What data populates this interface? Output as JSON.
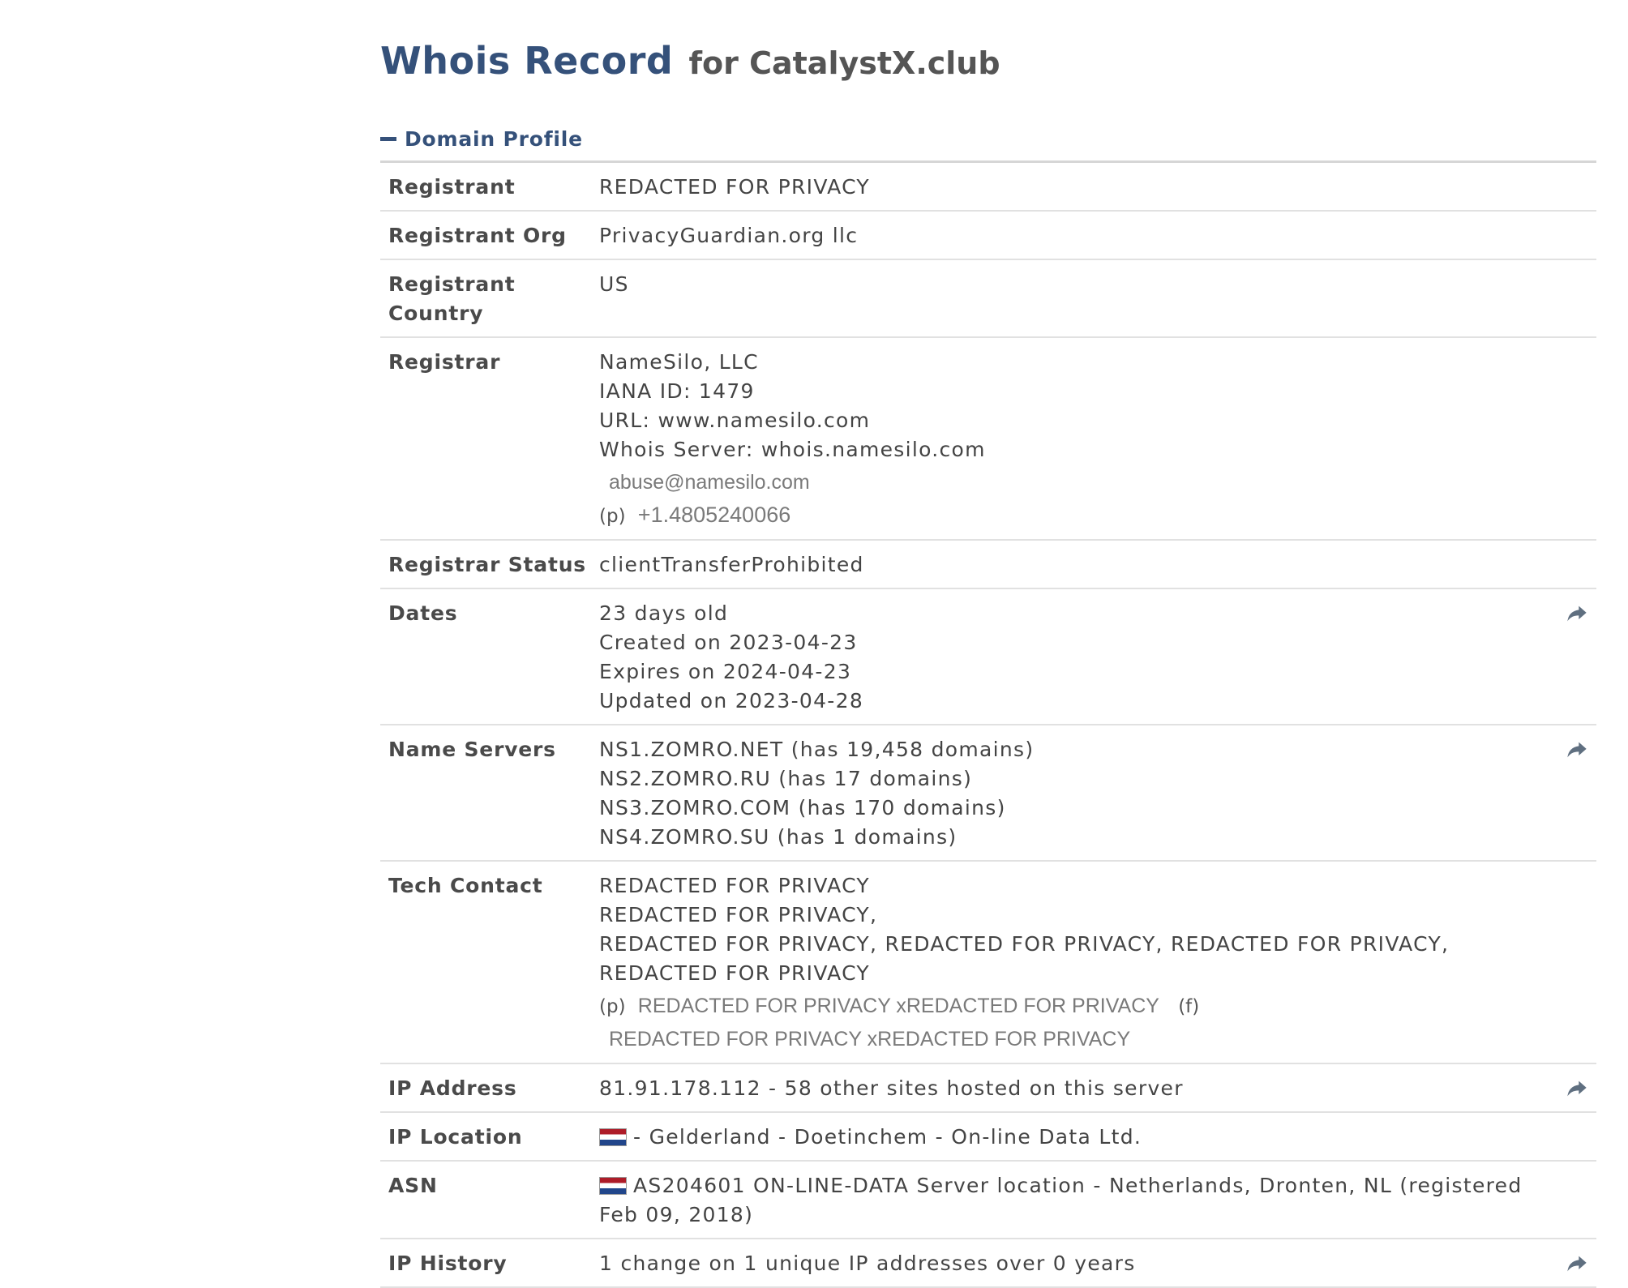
{
  "title": {
    "main": "Whois Record",
    "sub": "for CatalystX.club"
  },
  "section": {
    "label": "Domain Profile"
  },
  "rows": {
    "registrant": {
      "label": "Registrant",
      "value": "REDACTED FOR PRIVACY"
    },
    "registrant_org": {
      "label": "Registrant Org",
      "value": "PrivacyGuardian.org llc"
    },
    "registrant_country": {
      "label": "Registrant Country",
      "value": "US"
    },
    "registrar": {
      "label": "Registrar",
      "lines": [
        "NameSilo, LLC",
        "IANA ID: 1479",
        "URL: www.namesilo.com",
        "Whois Server: whois.namesilo.com"
      ],
      "email": "abuse@namesilo.com",
      "phone_prefix": "(p)",
      "phone": "+1.4805240066"
    },
    "registrar_status": {
      "label": "Registrar Status",
      "value": "clientTransferProhibited"
    },
    "dates": {
      "label": "Dates",
      "lines": [
        "23 days old",
        "Created on 2023-04-23",
        "Expires on 2024-04-23",
        "Updated on 2023-04-28"
      ]
    },
    "name_servers": {
      "label": "Name Servers",
      "lines": [
        "NS1.ZOMRO.NET (has 19,458 domains)",
        "NS2.ZOMRO.RU (has 17 domains)",
        "NS3.ZOMRO.COM (has 170 domains)",
        "NS4.ZOMRO.SU (has 1 domains)"
      ]
    },
    "tech_contact": {
      "label": "Tech Contact",
      "lines": [
        "REDACTED FOR PRIVACY",
        "REDACTED FOR PRIVACY,",
        "REDACTED FOR PRIVACY, REDACTED FOR PRIVACY, REDACTED FOR PRIVACY, REDACTED FOR PRIVACY"
      ],
      "phone_prefix": "(p)",
      "phone": "REDACTED FOR PRIVACY xREDACTED FOR PRIVACY",
      "fax_prefix": "(f)",
      "fax": "REDACTED FOR PRIVACY xREDACTED FOR PRIVACY"
    },
    "ip_address": {
      "label": "IP Address",
      "value": "81.91.178.112 - 58 other sites hosted on this server"
    },
    "ip_location": {
      "label": "IP Location",
      "value": "- Gelderland - Doetinchem - On-line Data Ltd."
    },
    "asn": {
      "label": "ASN",
      "value": "AS204601 ON-LINE-DATA Server location - Netherlands, Dronten, NL (registered Feb 09, 2018)"
    },
    "ip_history": {
      "label": "IP History",
      "value": "1 change on 1 unique IP addresses over 0 years"
    }
  },
  "icons": {
    "share": "share-arrow-icon",
    "flag": "netherlands-flag-icon",
    "collapse": "minus-icon"
  },
  "colors": {
    "title": "#35517a",
    "border": "#e1e1e1",
    "text": "#444444"
  }
}
